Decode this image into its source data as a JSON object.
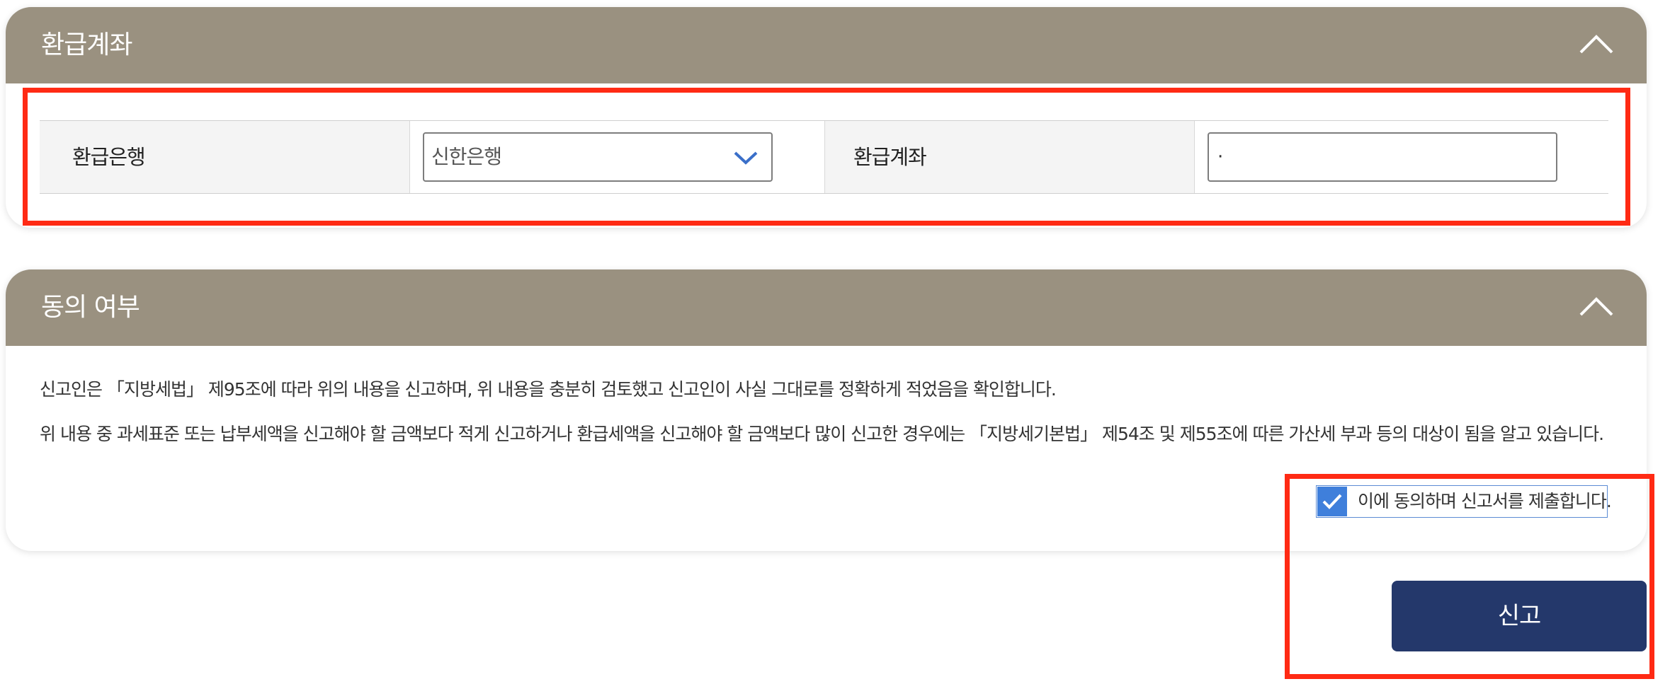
{
  "refund_account_section": {
    "title": "환급계좌",
    "bank_label": "환급은행",
    "bank_selected": "신한은행",
    "account_label": "환급계좌",
    "account_value": "·"
  },
  "consent_section": {
    "title": "동의 여부",
    "paragraph1": "신고인은 「지방세법」 제95조에 따라 위의 내용을 신고하며, 위 내용을 충분히 검토했고 신고인이 사실 그대로를 정확하게 적었음을 확인합니다.",
    "paragraph2": "위 내용 중 과세표준 또는 납부세액을 신고해야 할 금액보다 적게 신고하거나 환급세액을 신고해야 할 금액보다 많이 신고한 경우에는 「지방세기본법」 제54조 및 제55조에 따른 가산세 부과 등의 대상이 됨을 알고 있습니다.",
    "agree_label": "이에 동의하며 신고서를 제출합니다.",
    "agree_checked": true
  },
  "submit_label": "신고",
  "colors": {
    "header_bg": "#9a9180",
    "button_bg": "#24386b",
    "checkbox_bg": "#3f7fdb",
    "highlight": "#ff2a14"
  },
  "icons": {
    "collapse": "chevron-up-icon",
    "select": "chevron-down-icon",
    "check": "checkmark-icon"
  }
}
